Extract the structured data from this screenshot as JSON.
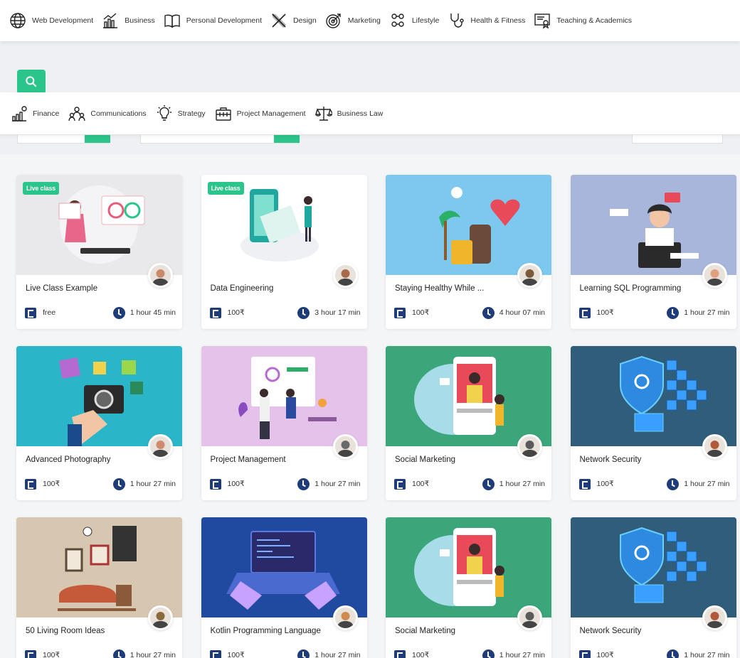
{
  "topnav": [
    {
      "label": "Web Development",
      "icon": "globe-icon"
    },
    {
      "label": "Business",
      "icon": "chart-icon"
    },
    {
      "label": "Personal Development",
      "icon": "book-icon"
    },
    {
      "label": "Design",
      "icon": "design-tools-icon"
    },
    {
      "label": "Marketing",
      "icon": "target-icon"
    },
    {
      "label": "Lifestyle",
      "icon": "people-icon"
    },
    {
      "label": "Health & Fitness",
      "icon": "stethoscope-icon"
    },
    {
      "label": "Teaching & Academics",
      "icon": "certificate-icon"
    }
  ],
  "subnav": [
    {
      "label": "Finance",
      "icon": "finance-icon"
    },
    {
      "label": "Communications",
      "icon": "team-icon"
    },
    {
      "label": "Strategy",
      "icon": "lightbulb-icon"
    },
    {
      "label": "Project Management",
      "icon": "briefcase-icon"
    },
    {
      "label": "Business Law",
      "icon": "scales-icon"
    }
  ],
  "colors": {
    "accent": "#2bc48a",
    "icon_blue": "#1f3c7a"
  },
  "courses": [
    {
      "title": "Live Class Example",
      "price": "free",
      "duration": "1 hour 45 min",
      "live": "Live class",
      "theme": "#e9e9ec"
    },
    {
      "title": "Data Engineering",
      "price": "100₹",
      "duration": "3 hour 17 min",
      "live": "Live class",
      "theme": "#ffffff"
    },
    {
      "title": "Staying Healthy While ...",
      "price": "100₹",
      "duration": "4 hour 07 min",
      "live": "",
      "theme": "#7cc8ef"
    },
    {
      "title": "Learning SQL Programming",
      "price": "100₹",
      "duration": "1 hour 27 min",
      "live": "",
      "theme": "#a9b6dc"
    },
    {
      "title": "Advanced Photography",
      "price": "100₹",
      "duration": "1 hour 27 min",
      "live": "",
      "theme": "#2bb5c8"
    },
    {
      "title": "Project Management",
      "price": "100₹",
      "duration": "1 hour 27 min",
      "live": "",
      "theme": "#e4c2ea"
    },
    {
      "title": "Social Marketing",
      "price": "100₹",
      "duration": "1 hour 27 min",
      "live": "",
      "theme": "#3aa67a"
    },
    {
      "title": "Network Security",
      "price": "100₹",
      "duration": "1 hour 27 min",
      "live": "",
      "theme": "#2f5d7a"
    },
    {
      "title": "50 Living Room Ideas",
      "price": "100₹",
      "duration": "1 hour 27 min",
      "live": "",
      "theme": "#d8c7b0"
    },
    {
      "title": "Kotlin Programming Language",
      "price": "100₹",
      "duration": "1 hour 27 min",
      "live": "",
      "theme": "#1f4aa0"
    },
    {
      "title": "Social Marketing",
      "price": "100₹",
      "duration": "1 hour 27 min",
      "live": "",
      "theme": "#3aa67a"
    },
    {
      "title": "Network Security",
      "price": "100₹",
      "duration": "1 hour 27 min",
      "live": "",
      "theme": "#2f5d7a"
    }
  ]
}
